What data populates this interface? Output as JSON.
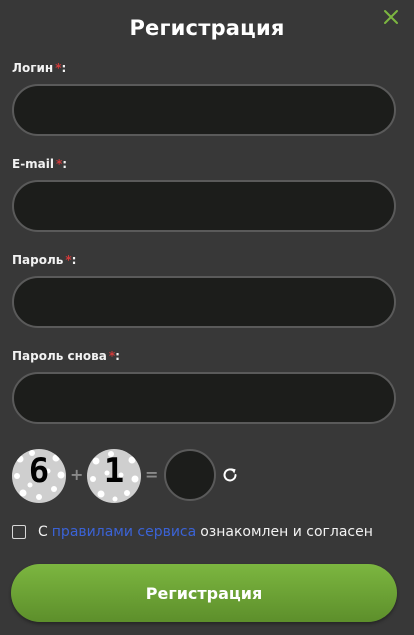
{
  "title": "Регистрация",
  "close_icon": "close-icon",
  "fields": {
    "login": {
      "label": "Логин",
      "required_mark": "*",
      "colon": ":",
      "value": "",
      "placeholder": ""
    },
    "email": {
      "label": "E-mail",
      "required_mark": "*",
      "colon": ":",
      "value": "",
      "placeholder": ""
    },
    "password": {
      "label": "Пароль",
      "required_mark": "*",
      "colon": ":",
      "value": "",
      "placeholder": ""
    },
    "password_repeat": {
      "label": "Пароль снова",
      "required_mark": "*",
      "colon": ":",
      "value": "",
      "placeholder": ""
    }
  },
  "captcha": {
    "first": "6",
    "operator": "+",
    "second": "1",
    "equals": "=",
    "answer": "",
    "refresh_icon": "refresh-icon"
  },
  "agreement": {
    "prefix": "С",
    "link": "правилами сервиса",
    "suffix": "ознакомлен и согласен",
    "checked": false
  },
  "submit_label": "Регистрация",
  "colors": {
    "background": "#383838",
    "accent": "#7cb640",
    "link": "#3b63d6",
    "required": "#d13a3a"
  }
}
